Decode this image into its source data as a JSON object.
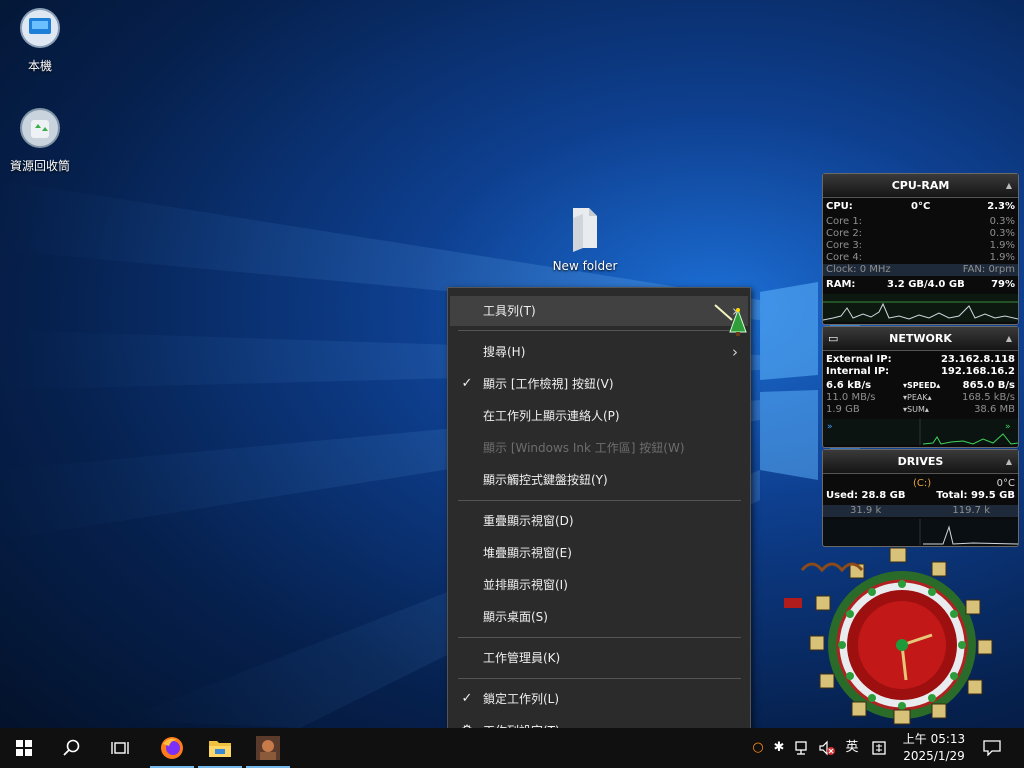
{
  "desktop": {
    "icons": [
      {
        "label": "本機",
        "icon": "computer-icon"
      },
      {
        "label": "資源回收筒",
        "icon": "recycle-bin-icon"
      },
      {
        "label": "New folder",
        "icon": "folder-icon"
      }
    ]
  },
  "context_menu": {
    "items": [
      {
        "label": "工具列(T)",
        "submenu": true,
        "highlighted": true
      },
      {
        "label": "搜尋(H)",
        "submenu": true
      },
      {
        "label": "顯示 [工作檢視] 按鈕(V)",
        "checked": true
      },
      {
        "label": "在工作列上顯示連絡人(P)"
      },
      {
        "label": "顯示 [Windows Ink 工作區] 按鈕(W)",
        "disabled": true
      },
      {
        "label": "顯示觸控式鍵盤按鈕(Y)"
      },
      {
        "label": "重疊顯示視窗(D)"
      },
      {
        "label": "堆疊顯示視窗(E)"
      },
      {
        "label": "並排顯示視窗(I)"
      },
      {
        "label": "顯示桌面(S)"
      },
      {
        "label": "工作管理員(K)"
      },
      {
        "label": "鎖定工作列(L)",
        "checked": true
      },
      {
        "label": "工作列設定(T)",
        "icon": "gear-icon"
      }
    ],
    "check_glyph": "✓",
    "arrow_glyph": "›"
  },
  "cpu_ram": {
    "title": "CPU-RAM",
    "cpu_label": "CPU:",
    "cpu_temp": "0°C",
    "cpu_pct": "2.3%",
    "cores": [
      {
        "label": "Core 1:",
        "value": "0.3%",
        "level": 0.003
      },
      {
        "label": "Core 2:",
        "value": "0.3%",
        "level": 0.003
      },
      {
        "label": "Core 3:",
        "value": "1.9%",
        "level": 0.019
      },
      {
        "label": "Core 4:",
        "value": "1.9%",
        "level": 0.019
      }
    ],
    "clock_label": "Clock: 0 MHz",
    "fan_label": "FAN: 0rpm",
    "ram_label": "RAM:",
    "ram_value": "3.2 GB/4.0 GB",
    "ram_pct": "79%"
  },
  "network": {
    "title": "NETWORK",
    "external_label": "External IP:",
    "external_ip": "23.162.8.118",
    "internal_label": "Internal IP:",
    "internal_ip": "192.168.16.2",
    "down_speed": "6.6 kB/s",
    "speed_label": "SPEED",
    "up_speed": "865.0 B/s",
    "down_peak": "11.0 MB/s",
    "peak_label": "PEAK",
    "up_peak": "168.5 kB/s",
    "down_sum": "1.9 GB",
    "sum_label": "SUM",
    "up_sum": "38.6 MB"
  },
  "drives": {
    "title": "DRIVES",
    "drive_letter": "(C:)",
    "temp": "0°C",
    "used": "Used: 28.8 GB",
    "total": "Total: 99.5 GB",
    "read": "31.9 k",
    "write": "119.7 k"
  },
  "taskbar": {
    "tray_lang": "英",
    "time": "上午 05:13",
    "date": "2025/1/29"
  }
}
